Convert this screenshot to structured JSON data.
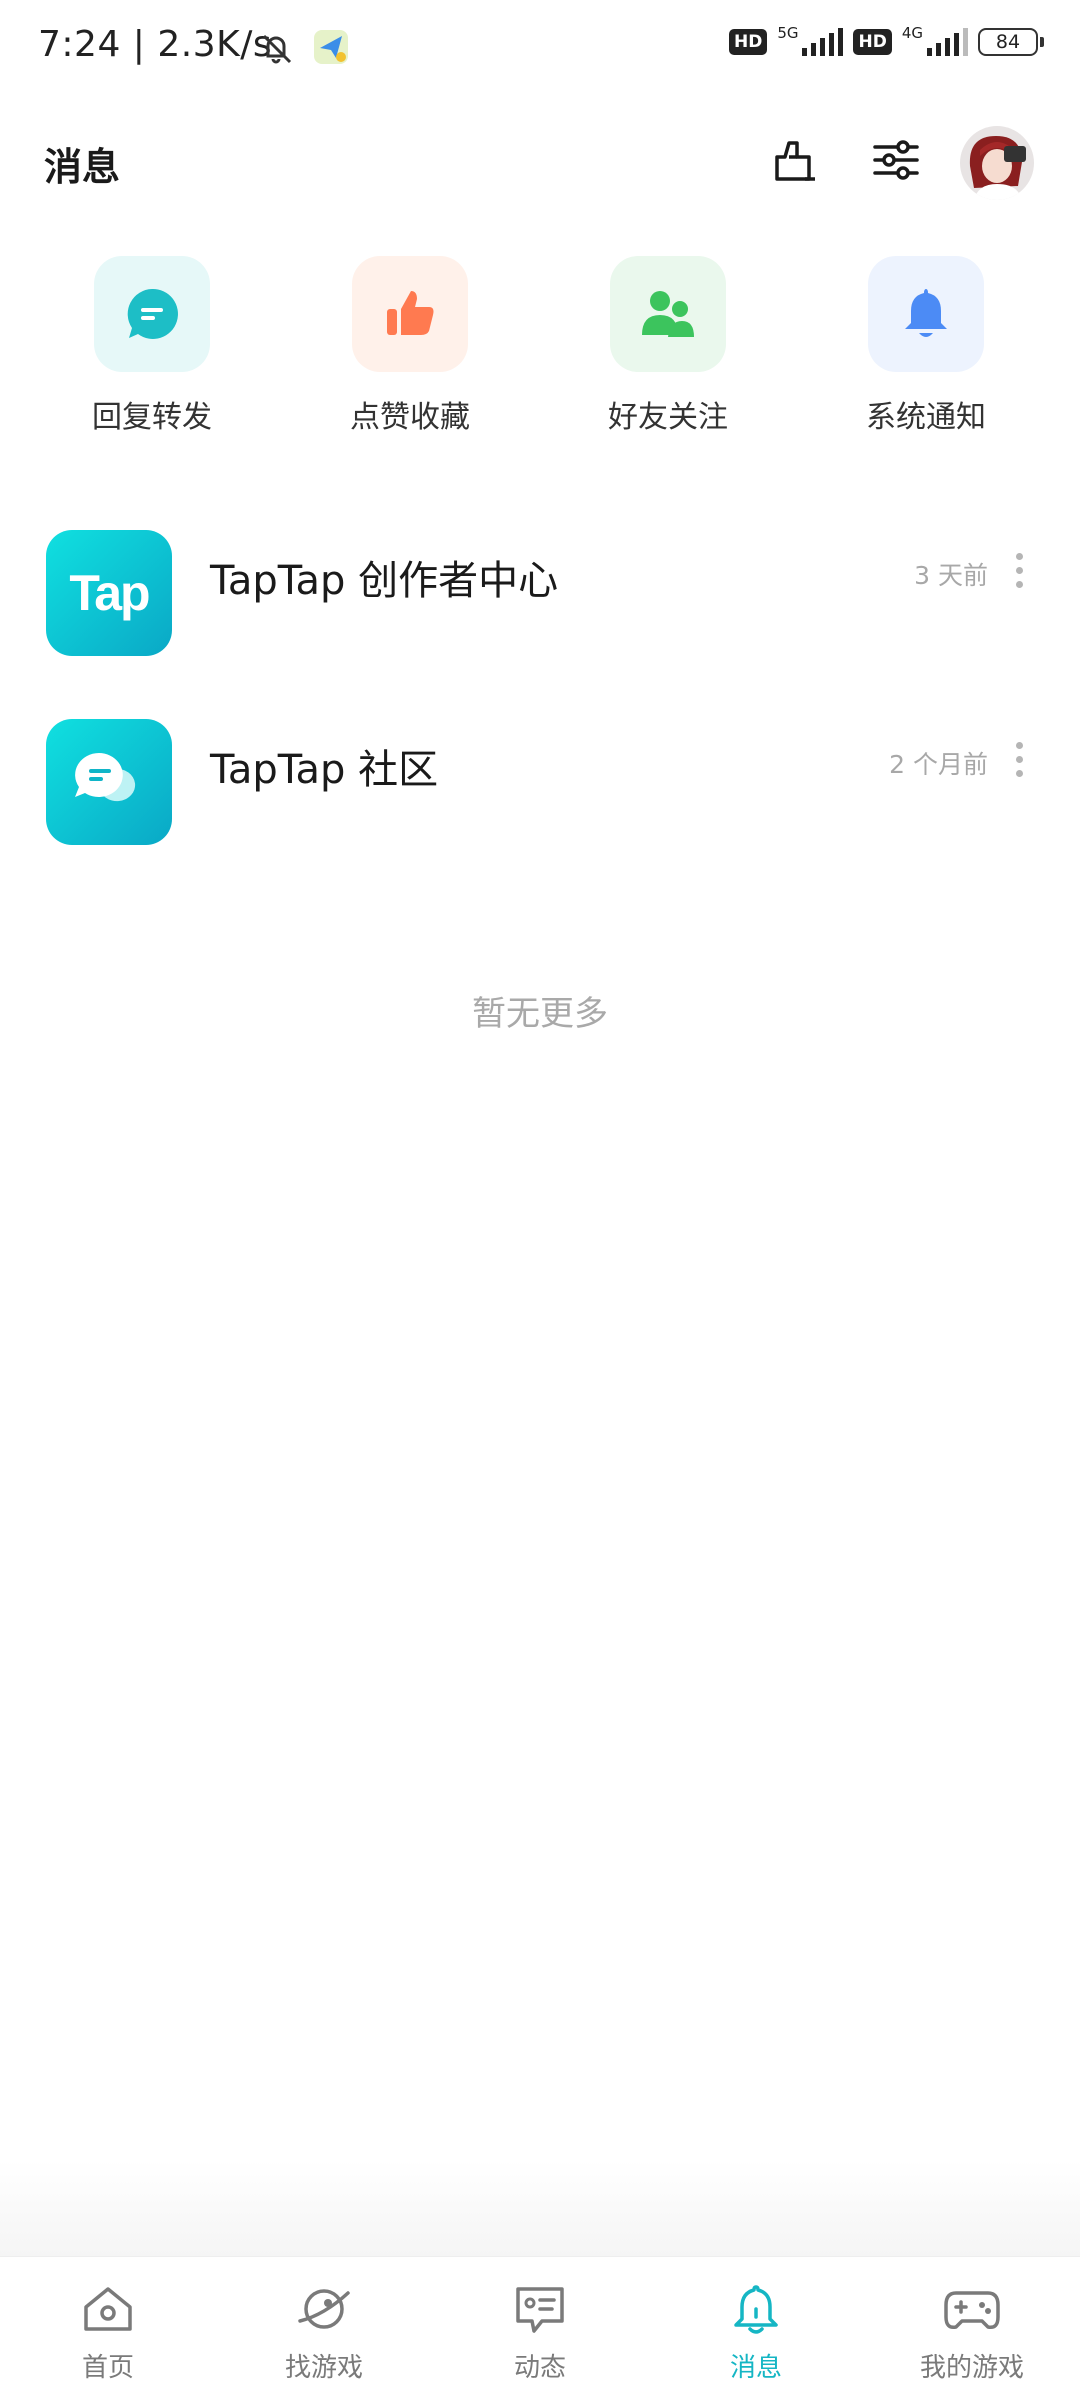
{
  "status_bar": {
    "time": "7:24 | 2.3K/s",
    "network_1": "5G",
    "network_2": "4G",
    "hd": "HD",
    "battery": "84"
  },
  "header": {
    "title": "消息"
  },
  "categories": [
    {
      "label": "回复转发",
      "icon": "reply-forward-icon",
      "color": "#1dbec6",
      "bg": "#e6f8f8"
    },
    {
      "label": "点赞收藏",
      "icon": "thumbs-up-icon",
      "color": "#ff7a50",
      "bg": "#fff1ea"
    },
    {
      "label": "好友关注",
      "icon": "friends-icon",
      "color": "#3cc45d",
      "bg": "#eaf8ed"
    },
    {
      "label": "系统通知",
      "icon": "bell-icon",
      "color": "#4c8bf5",
      "bg": "#edf3fe"
    }
  ],
  "messages": [
    {
      "title": "TapTap 创作者中心",
      "time": "3 天前",
      "logo_text": "Tap"
    },
    {
      "title": "TapTap 社区",
      "time": "2 个月前"
    }
  ],
  "empty_hint": "暂无更多",
  "bottom_nav": [
    {
      "label": "首页",
      "icon": "home-icon",
      "active": false
    },
    {
      "label": "找游戏",
      "icon": "discover-planet-icon",
      "active": false
    },
    {
      "label": "动态",
      "icon": "feed-icon",
      "active": false
    },
    {
      "label": "消息",
      "icon": "bell-icon",
      "active": true
    },
    {
      "label": "我的游戏",
      "icon": "gamepad-icon",
      "active": false
    }
  ],
  "colors": {
    "accent": "#15b6c4",
    "inactive": "#7a7a7a"
  }
}
